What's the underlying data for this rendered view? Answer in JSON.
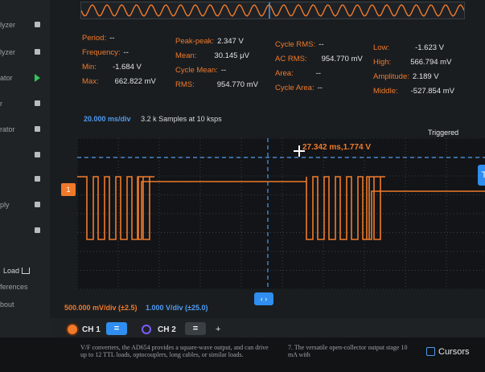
{
  "sidebar": {
    "items": [
      {
        "label": "lyzer",
        "control": "stop"
      },
      {
        "label": "lyzer",
        "control": "stop"
      },
      {
        "label": "ator",
        "control": "play"
      },
      {
        "label": "r",
        "control": "stop"
      },
      {
        "label": "rator",
        "control": "stop"
      },
      {
        "label": "",
        "control": "stop"
      },
      {
        "label": "",
        "control": "stop"
      },
      {
        "label": "ply",
        "control": "stop"
      },
      {
        "label": "",
        "control": "stop"
      }
    ],
    "load_label": "Load",
    "references_label": "ferences",
    "about_label": "bout"
  },
  "measurements": {
    "col1": [
      {
        "key": "Period:",
        "value": "--"
      },
      {
        "key": "Frequency:",
        "value": "--"
      },
      {
        "key": "Min:",
        "value": "-1.684 V"
      },
      {
        "key": "Max:",
        "value": "662.822 mV"
      }
    ],
    "col2": [
      {
        "key": "Peak-peak:",
        "value": "2.347 V"
      },
      {
        "key": "Mean:",
        "value": "30.145 μV"
      },
      {
        "key": "Cycle Mean:",
        "value": "--"
      },
      {
        "key": "RMS:",
        "value": "954.770 mV"
      }
    ],
    "col3": [
      {
        "key": "Cycle RMS:",
        "value": "--"
      },
      {
        "key": "AC RMS:",
        "value": "954.770 mV"
      },
      {
        "key": "Area:",
        "value": "--"
      },
      {
        "key": "Cycle Area:",
        "value": "--"
      }
    ],
    "col4": [
      {
        "key": "Low:",
        "value": "-1.623 V"
      },
      {
        "key": "High:",
        "value": "566.794 mV"
      },
      {
        "key": "Amplitude:",
        "value": "2.189 V"
      },
      {
        "key": "Middle:",
        "value": "-527.854 mV"
      }
    ]
  },
  "plot": {
    "timebase": "20.000 ms/div",
    "samples": "3.2 k Samples at 10 ksps",
    "status": "Triggered",
    "cursor_readout": "27.342 ms,1.774 V",
    "ch1_marker": "1",
    "trigger_marker": "T",
    "position_button": "‹ ›",
    "ch1_scale": "500.000 mV/div (±2.5)",
    "ch2_scale": "1.000 V/div (±25.0)",
    "trace_color": "#f07a2a",
    "trigger_color": "#4f9bf0"
  },
  "channels": {
    "ch1_label": "CH 1",
    "ch1_button": "=",
    "ch2_label": "CH 2",
    "ch2_button": "=",
    "add_label": "+",
    "ch1_color": "#f07a2a",
    "ch2_color": "#7b5cff"
  },
  "paper": {
    "text_left": "V/F converters, the AD654 provides a square-wave output, and can drive up to 12 TTL loads, optocouplers, long cables, or similar loads.",
    "text_right": "7. The versatile open-collector output stage 10 mA with"
  },
  "cursors_label": "Cursors"
}
